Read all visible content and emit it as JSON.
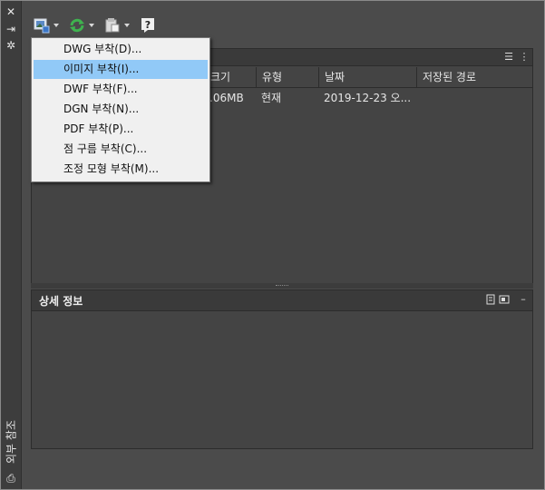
{
  "palette": {
    "page_bg": "#4b4b4b",
    "panel_bg": "#444444",
    "menu_bg": "#f0f0f0",
    "menu_highlight": "#91c9f7",
    "refresh_green": "#3fb34f"
  },
  "sidebar": {
    "title": "외부 참조",
    "icons": [
      "close-icon",
      "auto-hide-icon",
      "properties-icon",
      "xref-icon"
    ]
  },
  "toolbar": {
    "buttons": [
      {
        "name": "attach-dropdown",
        "icon": "attach-image-icon"
      },
      {
        "name": "refresh-dropdown",
        "icon": "refresh-icon"
      },
      {
        "name": "change-path-dropdown",
        "icon": "change-path-icon"
      },
      {
        "name": "help-button",
        "icon": "help-icon"
      }
    ]
  },
  "attach_menu": {
    "items": [
      "DWG 부착(D)...",
      "이미지 부착(I)...",
      "DWF 부착(F)...",
      "DGN 부착(N)...",
      "PDF 부착(P)...",
      "점 구름 부착(C)...",
      "조정 모형 부착(M)..."
    ],
    "highlighted_index": 1
  },
  "file_refs": {
    "header_icons": [
      "list-view-icon",
      "tree-view-icon"
    ],
    "columns": [
      "크기",
      "유형",
      "날짜",
      "저장된 경로"
    ],
    "rows": [
      {
        "size": ".06MB",
        "type": "현재",
        "date": "2019-12-23 오...",
        "saved_path": ""
      }
    ]
  },
  "details": {
    "title": "상세 정보",
    "header_icons": [
      "details-icon",
      "preview-icon",
      "minimize-icon"
    ]
  }
}
